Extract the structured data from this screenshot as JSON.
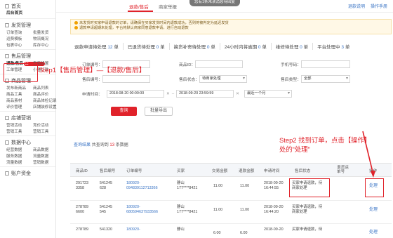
{
  "toast": "您有1条未读消息待回复",
  "top_tabs": [
    "退款/售后",
    "商家举报"
  ],
  "top_right": [
    "退款说明",
    "操作手册"
  ],
  "sidebar": {
    "home": "首页",
    "backend_home": "后台首页",
    "shipping": {
      "title": "发货管理",
      "rows": [
        [
          "订单查询",
          "批量发货"
        ],
        [
          "运费模板",
          "物流概况"
        ],
        [
          "包裹中心",
          "库存中心"
        ]
      ]
    },
    "aftersale": {
      "title": "售后管理",
      "selected": "退款/售后",
      "badge": "13",
      "rows": [
        [
          "退款/售后",
          "售后设置"
        ],
        [
          "工单管理",
          "小额打款"
        ]
      ]
    },
    "goods": {
      "title": "商品管理",
      "rows": [
        [
          "发布新商品",
          "商品列表"
        ],
        [
          "商品工具",
          "商品评价"
        ],
        [
          "商品素材",
          "商品体检记录"
        ],
        [
          "评价管理",
          "店铺装修设置"
        ]
      ]
    },
    "shop": {
      "title": "店铺营销",
      "rows": [
        [
          "营销活动",
          "竞价活动"
        ],
        [
          "营销工具",
          "营销工具"
        ]
      ]
    },
    "data": {
      "title": "数据中心",
      "rows": [
        [
          "经营数据",
          "商品数据"
        ],
        [
          "服务数据",
          "流量数据"
        ],
        [
          "流量数据",
          "营销数据"
        ]
      ]
    },
    "account": "账户资金"
  },
  "notice": [
    "未发货时买家申请退款的订单，请确保在买家发货时间内退款成功，否则将被判定为延迟发货",
    "退款申请超期未处理，平台将默认商家同意退款申请，进行自动退款"
  ],
  "stats": [
    {
      "label": "退款申请待处理",
      "num": "12",
      "unit": "单"
    },
    {
      "label": "已退货待处理",
      "num": "0",
      "unit": "单"
    },
    {
      "label": "换货补寄待处理",
      "num": "0",
      "unit": "单"
    },
    {
      "label": "24小时内将逾期",
      "num": "0",
      "unit": "单"
    },
    {
      "label": "维修待处理",
      "num": "0",
      "unit": "单"
    },
    {
      "label": "平台处理中",
      "num": "3",
      "unit": "单"
    }
  ],
  "filters": {
    "order_no_label": "订单编号：",
    "goods_id_label": "商品ID：",
    "phone_label": "手机号码：",
    "aftersale_no_label": "售后编号：",
    "status_label": "售后状态：",
    "status_value": "待商家处理",
    "type_label": "售后类型：",
    "type_value": "全部",
    "time_label": "申请时间：",
    "time_start": "2018-08-20 00:00:00",
    "time_end": "2018-09-20 23:59:59",
    "range_value": "最近一个月"
  },
  "buttons": {
    "query": "查询",
    "export": "批量导出"
  },
  "results": {
    "label": "查询结果",
    "prefix": "共查询到",
    "count": "13",
    "suffix": "条数据"
  },
  "table": {
    "headers": [
      "商品ID",
      "售后编号",
      "订单编号",
      "买家",
      "交易金额",
      "退款金额",
      "申请时间",
      "售后状态",
      "退货运单号",
      "操作"
    ],
    "rows": [
      {
        "goods_id": [
          "291723",
          "3358"
        ],
        "aftersale_no": [
          "541245",
          "628"
        ],
        "order_no": [
          "180920-",
          "094839112713366"
        ],
        "buyer": [
          "静山",
          "177****8421"
        ],
        "amount": "11.00",
        "refund": "11.00",
        "time": [
          "2018-09-20",
          "16:44:55"
        ],
        "status": [
          "买家申请退款，待",
          "商家处理"
        ],
        "waybill": "",
        "action": "处理"
      },
      {
        "goods_id": [
          "278789",
          "6600"
        ],
        "aftersale_no": [
          "541245",
          "545"
        ],
        "order_no": [
          "180920-",
          "680594637933566"
        ],
        "buyer": [
          "静山",
          "177****8421"
        ],
        "amount": "11.00",
        "refund": "11.00",
        "time": [
          "2018-09-20",
          "16:44:20"
        ],
        "status": [
          "买家申请退款，待",
          "商家处理"
        ],
        "waybill": "",
        "action": "处理"
      },
      {
        "goods_id": [
          "278789",
          ""
        ],
        "aftersale_no": [
          "541320",
          ""
        ],
        "order_no": [
          "180920-",
          ""
        ],
        "buyer": [
          "静山",
          ""
        ],
        "amount": "6.00",
        "refund": "6.00",
        "time": [
          "2018-09-20",
          ""
        ],
        "status": [
          "买家申请退款，待",
          ""
        ],
        "waybill": "",
        "action": "处理"
      }
    ]
  },
  "annotations": {
    "step1": "Step1【售后管理】—【退款/售后】",
    "step2": "Step2 找到订单，点击【操作】处的“处理”"
  },
  "colors": {
    "accent": "#e0222a",
    "link": "#3a74c5"
  }
}
